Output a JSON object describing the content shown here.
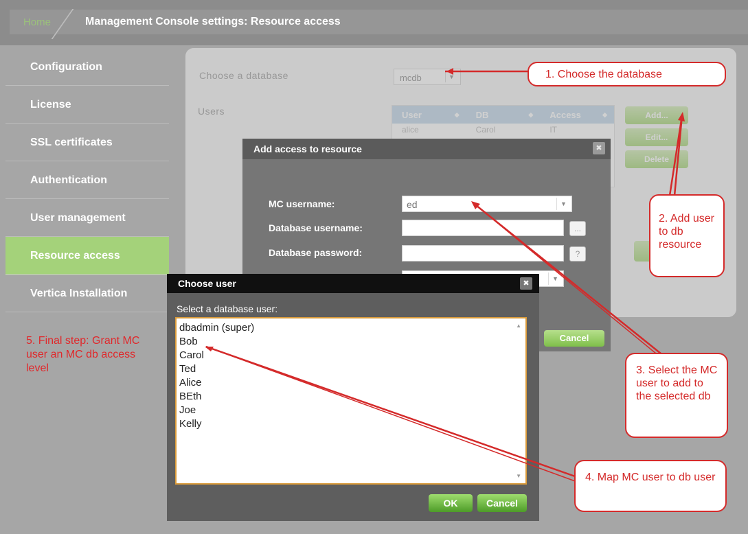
{
  "breadcrumb": {
    "home": "Home",
    "title": "Management Console settings: Resource access"
  },
  "sidebar": {
    "items": [
      {
        "label": "Configuration"
      },
      {
        "label": "License"
      },
      {
        "label": "SSL certificates"
      },
      {
        "label": "Authentication"
      },
      {
        "label": "User management"
      },
      {
        "label": "Resource access",
        "active": true
      },
      {
        "label": "Vertica Installation"
      }
    ]
  },
  "resource_panel": {
    "choose_db_label": "Choose a database",
    "db_value": "mcdb",
    "users_label": "Users",
    "table": {
      "headers": [
        "User",
        "DB",
        "Access"
      ],
      "rows": [
        [
          "alice",
          "Carol",
          "IT"
        ]
      ]
    },
    "buttons": {
      "add": "Add...",
      "edit": "Edit...",
      "delete": "Delete"
    },
    "cancel": "Cancel"
  },
  "add_access_dialog": {
    "title": "Add access to resource",
    "close": "✖",
    "mc_username_label": "MC username:",
    "mc_username_value": "ed",
    "db_username_label": "Database username:",
    "db_username_value": "",
    "db_password_label": "Database password:",
    "db_password_value": "",
    "browse_glyph": "...",
    "help_glyph": "?",
    "cancel": "Cancel"
  },
  "choose_user_dialog": {
    "title": "Choose user",
    "close": "✖",
    "prompt": "Select a database user:",
    "users": [
      "dbadmin (super)",
      "Bob",
      "Carol",
      "Ted",
      "Alice",
      "BEth",
      "Joe",
      "Kelly"
    ],
    "ok": "OK",
    "cancel": "Cancel"
  },
  "callouts": {
    "step1": "1. Choose the database",
    "step2": "2. Add user to db resource",
    "step3": "3. Select the MC user to add to the selected db",
    "step4": "4. Map MC user to db user",
    "step5": "5. Final step: Grant MC user an MC db access level"
  },
  "colors": {
    "callout_red": "#d42a2a",
    "accent_green": "#a4d27a",
    "listbox_border": "#d99a3a"
  }
}
